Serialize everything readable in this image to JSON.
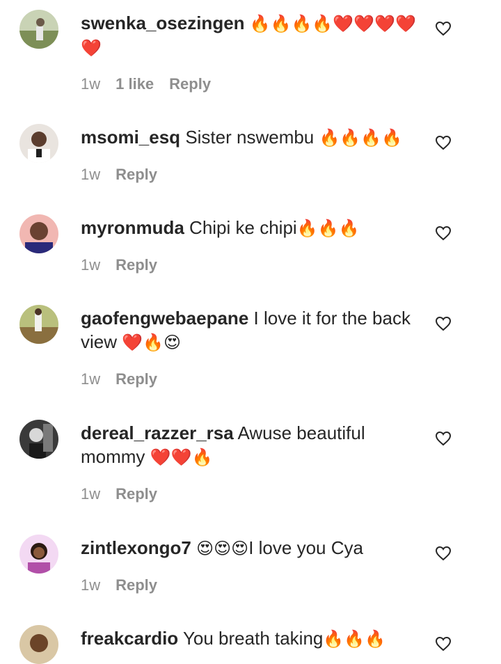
{
  "comments": [
    {
      "username": "swenka_osezingen",
      "text": "",
      "emoji": "🔥🔥🔥🔥❤️❤️❤️❤️❤️",
      "time": "1w",
      "likes": "1 like",
      "reply": "Reply"
    },
    {
      "username": "msomi_esq",
      "text": "Sister nswembu",
      "emoji": "🔥🔥🔥🔥",
      "time": "1w",
      "reply": "Reply"
    },
    {
      "username": "myronmuda",
      "text": "Chipi ke chipi",
      "emoji": "🔥🔥🔥",
      "time": "1w",
      "reply": "Reply"
    },
    {
      "username": "gaofengwebaepane",
      "text": "I love it for the back view",
      "emoji": "❤️🔥😍",
      "time": "1w",
      "reply": "Reply"
    },
    {
      "username": "dereal_razzer_rsa",
      "text": "Awuse beautiful mommy",
      "emoji": "❤️❤️🔥",
      "time": "1w",
      "reply": "Reply"
    },
    {
      "username": "zintlexongo7",
      "text": "I love you Cya",
      "emoji": "😍😍😍",
      "time": "1w",
      "reply": "Reply"
    },
    {
      "username": "freakcardio",
      "text": "You breath taking",
      "emoji": "🔥🔥🔥",
      "time": "",
      "reply": ""
    }
  ],
  "colors": {
    "text": "#262626",
    "meta": "#8e8e8e",
    "heart_outline": "#262626"
  }
}
